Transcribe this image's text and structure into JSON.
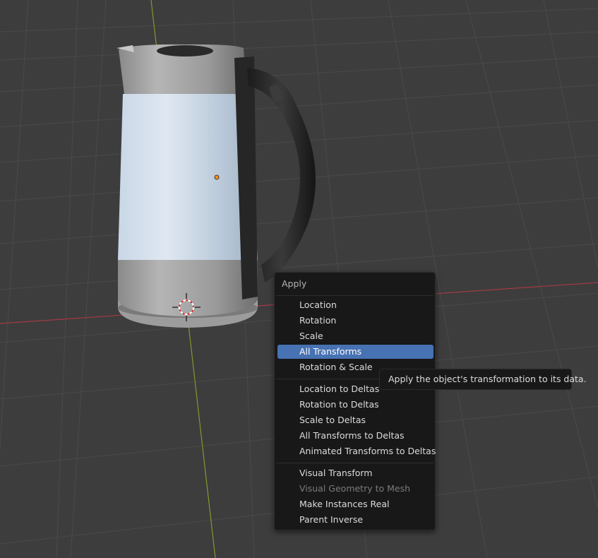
{
  "menu": {
    "title": "Apply",
    "groups": [
      [
        {
          "label": "Location",
          "state": "normal"
        },
        {
          "label": "Rotation",
          "state": "normal"
        },
        {
          "label": "Scale",
          "state": "normal"
        },
        {
          "label": "All Transforms",
          "state": "active"
        },
        {
          "label": "Rotation & Scale",
          "state": "normal"
        }
      ],
      [
        {
          "label": "Location to Deltas",
          "state": "normal"
        },
        {
          "label": "Rotation to Deltas",
          "state": "normal"
        },
        {
          "label": "Scale to Deltas",
          "state": "normal"
        },
        {
          "label": "All Transforms to Deltas",
          "state": "normal"
        },
        {
          "label": "Animated Transforms to Deltas",
          "state": "normal"
        }
      ],
      [
        {
          "label": "Visual Transform",
          "state": "normal"
        },
        {
          "label": "Visual Geometry to Mesh",
          "state": "disabled"
        },
        {
          "label": "Make Instances Real",
          "state": "normal"
        },
        {
          "label": "Parent Inverse",
          "state": "normal"
        }
      ]
    ]
  },
  "tooltip": {
    "text": "Apply the object's transformation to its data."
  },
  "colors": {
    "viewport_bg": "#3d3d3d",
    "grid_line": "#4a4a4a",
    "x_axis": "#a33a44",
    "y_axis": "#7f9a2f",
    "origin_dot": "#ff8c1a",
    "highlight": "#4772b3"
  }
}
